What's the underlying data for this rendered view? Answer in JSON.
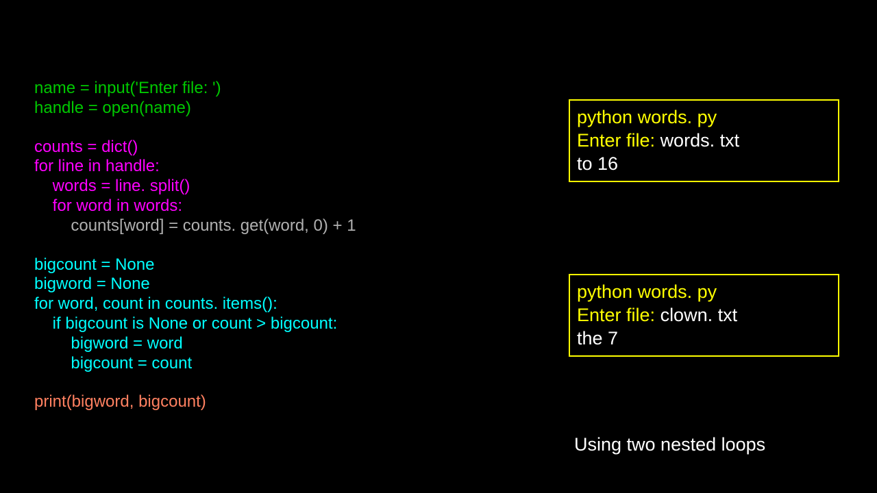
{
  "code": {
    "l1": "name = input('Enter file: ')",
    "l2": "handle = open(name)",
    "l3": "counts = dict()",
    "l4": "for line in handle:",
    "l5": "    words = line. split()",
    "l6": "    for word in words:",
    "l7": "        counts[word] = counts. get(word, 0) + 1",
    "l8": "bigcount = None",
    "l9": "bigword = None",
    "l10": "for word, count in counts. items():",
    "l11": "    if bigcount is None or count > bigcount:",
    "l12": "        bigword = word",
    "l13": "        bigcount = count",
    "l14": "print(bigword, bigcount)"
  },
  "output1": {
    "line1_a": "python words. py",
    "line2_a": "Enter file: ",
    "line2_b": "words. txt",
    "line3_a": "to 16"
  },
  "output2": {
    "line1_a": "python words. py",
    "line2_a": "Enter file: ",
    "line2_b": "clown. txt",
    "line3_a": "the 7"
  },
  "caption": "Using two nested loops"
}
